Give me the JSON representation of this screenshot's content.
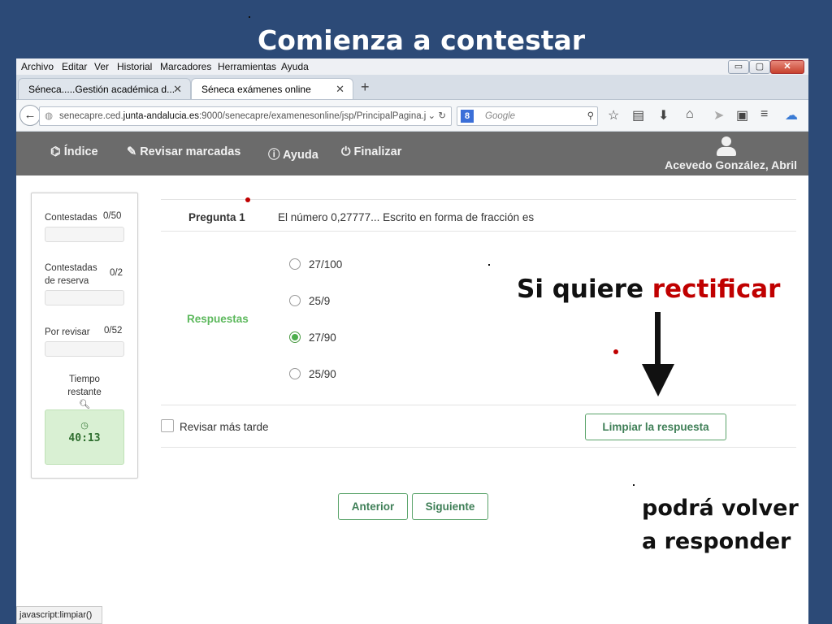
{
  "slide": {
    "title": "Comienza a contestar",
    "callout_rectify_prefix": "Si quiere ",
    "callout_rectify_highlight": "rectificar",
    "callout_answer_line1": "podrá volver",
    "callout_answer_line2": "a responder"
  },
  "browser": {
    "menu": [
      "Archivo",
      "Editar",
      "Ver",
      "Historial",
      "Marcadores",
      "Herramientas",
      "Ayuda"
    ],
    "window_controls": {
      "minimize": "▭",
      "maximize": "▢",
      "close": "✕"
    },
    "tabs": [
      {
        "label": "Séneca.....Gestión académica d..."
      },
      {
        "label": "Séneca exámenes online"
      }
    ],
    "url_prefix": "senecapre.ced.",
    "url_domain": "junta-andalucia.es",
    "url_suffix": ":9000/senecapre/examenesonline/jsp/PrincipalPagina.j",
    "search_placeholder": "Google",
    "status_text": "javascript:limpiar()"
  },
  "app": {
    "nav": {
      "index": "Índice",
      "review_marked": "Revisar marcadas",
      "help": "Ayuda",
      "finish": "Finalizar"
    },
    "user_name": "Acevedo González, Abril",
    "sidebar": {
      "answered_label": "Contestadas",
      "answered_value": "0/50",
      "reserve_label_line1": "Contestadas",
      "reserve_label_line2": "de reserva",
      "reserve_value": "0/2",
      "to_review_label": "Por revisar",
      "to_review_value": "0/52",
      "time_label_line1": "Tiempo",
      "time_label_line2": "restante",
      "time_value": "40:13"
    },
    "question": {
      "label": "Pregunta 1",
      "text": "El número 0,27777... Escrito en forma de fracción es",
      "answers_label": "Respuestas",
      "options": [
        "27/100",
        "25/9",
        "27/90",
        "25/90"
      ],
      "selected_index": 2,
      "review_later_label": "Revisar más tarde",
      "clear_button": "Limpiar la respuesta",
      "prev_button": "Anterior",
      "next_button": "Siguiente"
    }
  }
}
